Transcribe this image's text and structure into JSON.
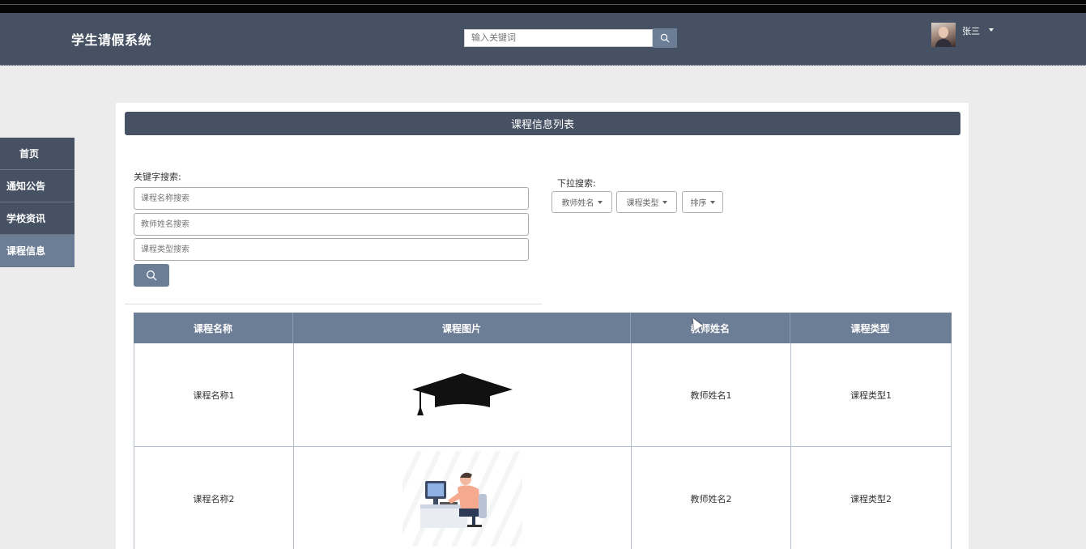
{
  "header": {
    "brand": "学生请假系统",
    "search_placeholder": "输入关键词",
    "user_name": "张三"
  },
  "sidebar": {
    "items": [
      {
        "label": "首页",
        "active": false
      },
      {
        "label": "通知公告",
        "active": false
      },
      {
        "label": "学校资讯",
        "active": false
      },
      {
        "label": "课程信息",
        "active": true
      }
    ]
  },
  "panel": {
    "title": "课程信息列表",
    "keyword_label": "关键字搜索:",
    "fields": [
      {
        "placeholder": "课程名称搜索"
      },
      {
        "placeholder": "教师姓名搜索"
      },
      {
        "placeholder": "课程类型搜索"
      }
    ],
    "dropdown_label": "下拉搜索:",
    "dropdowns": [
      {
        "label": "教师姓名"
      },
      {
        "label": "课程类型"
      },
      {
        "label": "排序"
      }
    ]
  },
  "table": {
    "headers": [
      "课程名称",
      "课程图片",
      "教师姓名",
      "课程类型"
    ],
    "rows": [
      {
        "name": "课程名称1",
        "image_icon": "graduation-cap-icon",
        "teacher": "教师姓名1",
        "type": "课程类型1"
      },
      {
        "name": "课程名称2",
        "image_icon": "person-at-computer-illustration",
        "teacher": "教师姓名2",
        "type": "课程类型2"
      }
    ]
  },
  "colors": {
    "header_bg": "#465263",
    "accent": "#6c7d96",
    "page_bg": "#ececec"
  }
}
